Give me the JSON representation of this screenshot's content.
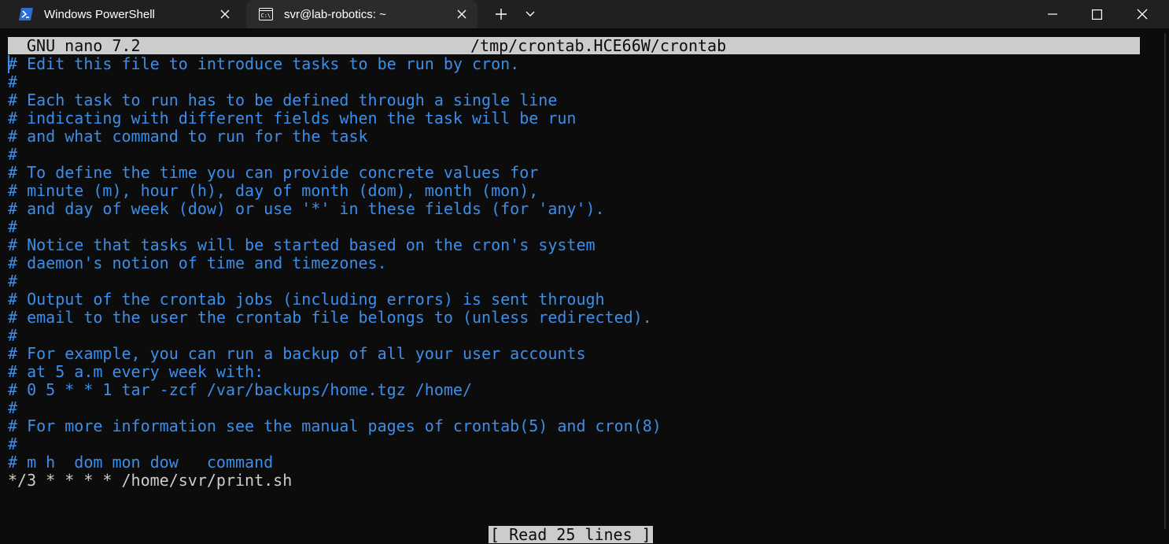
{
  "window": {
    "tabs": [
      {
        "label": "Windows PowerShell",
        "icon": "powershell-icon",
        "active": false
      },
      {
        "label": "svr@lab-robotics: ~",
        "icon": "terminal-icon",
        "active": true
      }
    ],
    "controls": {
      "new_tab": "+",
      "dropdown": "⌄",
      "minimize": "—",
      "maximize": "☐",
      "close": "✕"
    }
  },
  "nano": {
    "version": "GNU nano 7.2",
    "filename": "/tmp/crontab.HCE66W/crontab",
    "status": "[ Read 25 lines ]",
    "lines": [
      {
        "text": "# Edit this file to introduce tasks to be run by cron.",
        "type": "comment"
      },
      {
        "text": "#",
        "type": "comment"
      },
      {
        "text": "# Each task to run has to be defined through a single line",
        "type": "comment"
      },
      {
        "text": "# indicating with different fields when the task will be run",
        "type": "comment"
      },
      {
        "text": "# and what command to run for the task",
        "type": "comment"
      },
      {
        "text": "#",
        "type": "comment"
      },
      {
        "text": "# To define the time you can provide concrete values for",
        "type": "comment"
      },
      {
        "text": "# minute (m), hour (h), day of month (dom), month (mon),",
        "type": "comment"
      },
      {
        "text": "# and day of week (dow) or use '*' in these fields (for 'any').",
        "type": "comment"
      },
      {
        "text": "#",
        "type": "comment"
      },
      {
        "text": "# Notice that tasks will be started based on the cron's system",
        "type": "comment"
      },
      {
        "text": "# daemon's notion of time and timezones.",
        "type": "comment"
      },
      {
        "text": "#",
        "type": "comment"
      },
      {
        "text": "# Output of the crontab jobs (including errors) is sent through",
        "type": "comment"
      },
      {
        "text": "# email to the user the crontab file belongs to (unless redirected).",
        "type": "comment"
      },
      {
        "text": "#",
        "type": "comment"
      },
      {
        "text": "# For example, you can run a backup of all your user accounts",
        "type": "comment"
      },
      {
        "text": "# at 5 a.m every week with:",
        "type": "comment"
      },
      {
        "text": "# 0 5 * * 1 tar -zcf /var/backups/home.tgz /home/",
        "type": "comment"
      },
      {
        "text": "#",
        "type": "comment"
      },
      {
        "text": "# For more information see the manual pages of crontab(5) and cron(8)",
        "type": "comment"
      },
      {
        "text": "#",
        "type": "comment"
      },
      {
        "text": "# m h  dom mon dow   command",
        "type": "comment"
      },
      {
        "text": "*/3 * * * * /home/svr/print.sh",
        "type": "plain"
      }
    ]
  },
  "colors": {
    "comment": "#3b8eea",
    "text": "#cccccc",
    "background": "#0c0c0c",
    "titlebar": "#202020",
    "active_tab": "#2b2b2b"
  }
}
